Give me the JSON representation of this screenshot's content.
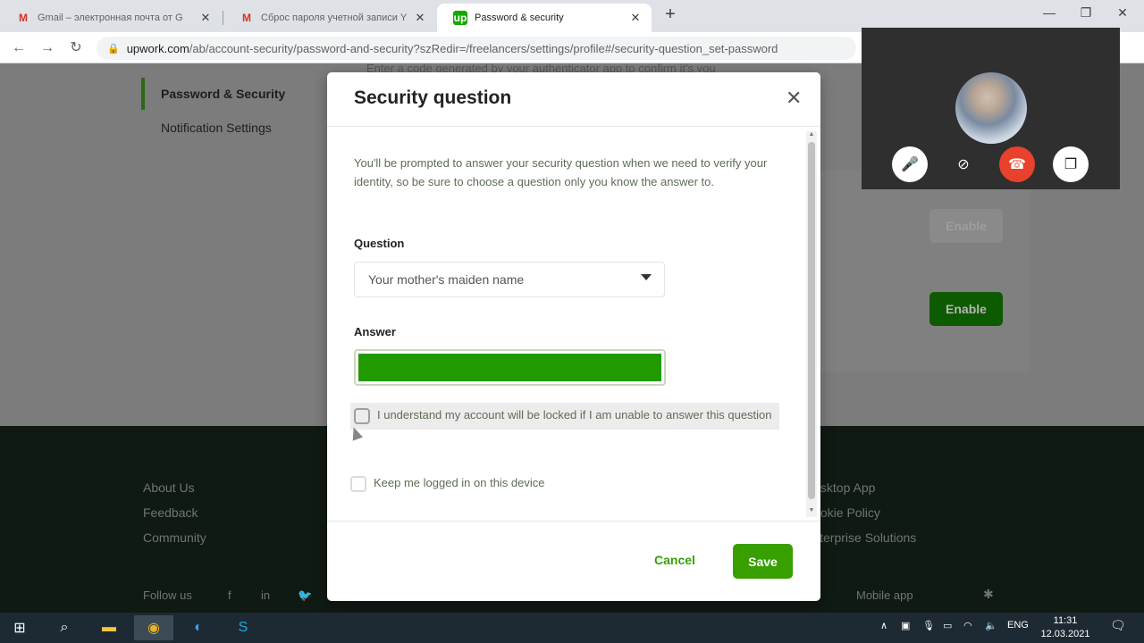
{
  "browser": {
    "tabs": [
      {
        "title": "Gmail – электронная почта от G",
        "favicon": "gmail-icon",
        "active": false
      },
      {
        "title": "Сброс пароля учетной записи Y",
        "favicon": "gmail-icon",
        "active": false
      },
      {
        "title": "Password & security",
        "favicon": "upwork-icon",
        "active": true
      }
    ],
    "favicon_text": {
      "gmail": "M",
      "upwork": "up"
    },
    "new_tab_symbol": "+",
    "url_host": "upwork.com",
    "url_path": "/ab/account-security/password-and-security?szRedir=/freelancers/settings/profile#/security-question_set-password"
  },
  "page": {
    "top_cut_text": "Enter a code generated by your authenticator app to confirm it's you",
    "sidebar": [
      {
        "label": "Password & Security",
        "active": true
      },
      {
        "label": "Notification Settings",
        "active": false
      }
    ],
    "enable_buttons": [
      "Enable",
      "Enable"
    ],
    "footer_links_left": [
      "About Us",
      "Feedback",
      "Community"
    ],
    "footer_links_right": [
      "Desktop App",
      "Cookie Policy",
      "Enterprise Solutions"
    ],
    "follow_us": "Follow us",
    "mobile_app": "Mobile app",
    "social_icons": [
      "f",
      "in",
      "🐦"
    ]
  },
  "modal": {
    "title": "Security question",
    "description": "You'll be prompted to answer your security question when we need to verify your identity, so be sure to choose a question only you know the answer to.",
    "question_label": "Question",
    "question_selected": "Your mother's maiden name",
    "answer_label": "Answer",
    "checkbox_locked_label": "I understand my account will be locked if I am unable to answer this question",
    "checkbox_keep_logged_label": "Keep me logged in on this device",
    "cancel_label": "Cancel",
    "save_label": "Save"
  },
  "taskbar": {
    "language": "ENG",
    "time": "11:31",
    "date": "12.03.2021"
  },
  "colors": {
    "accent": "#37a000",
    "accent_dark": "#14a800",
    "danger": "#e8412c",
    "footer_bg": "#0f1a12"
  }
}
